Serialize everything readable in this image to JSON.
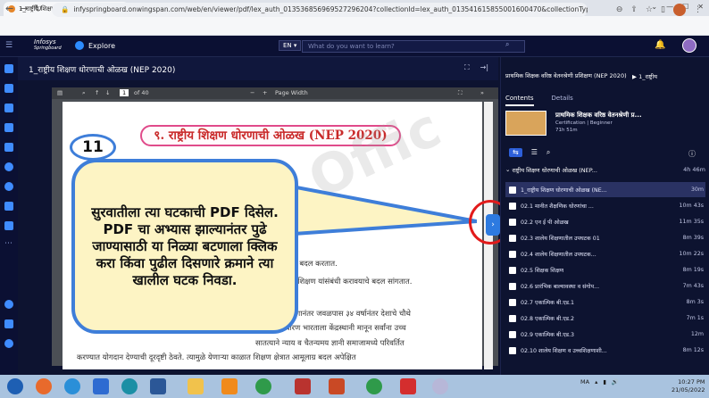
{
  "browser": {
    "tab_title": "1_राष्ट्रीय शिक्षण धोरणाची ओळख (NE",
    "tab_close": "×",
    "new_tab": "+",
    "url": "infyspringboard.onwingspan.com/web/en/viewer/pdf/lex_auth_013536856969527296204?collectionId=lex_auth_013541615855001600470&collectionType=C...",
    "window_controls": [
      "⌄",
      "—",
      "☐",
      "✕"
    ]
  },
  "header": {
    "logo_line1": "Infosys",
    "logo_line2": "Springboard",
    "explore_label": "Explore",
    "language": "EN",
    "search_placeholder": "What do you want to learn?"
  },
  "course": {
    "title": "1_राष्ट्रीय शिक्षण धोरणाची ओळख (NEP 2020)"
  },
  "pdf": {
    "page_label": "1",
    "page_total": "of 40",
    "zoom": "Page Width",
    "zoom_minus": "−",
    "zoom_plus": "+",
    "heading": "९. राष्ट्रीय शिक्षण धोरणाची ओळख (NEP 2020)",
    "lines": [
      "तात.",
      "अनुरूप बदल करतात.",
      "शिक्षक शिक्षण यांसंबंधी करावयाचे बदल सांगतात.",
      "क धोरणानंतर जवळपास ३४ वर्षानंतर देशाचे चौथे",
      "क धोरण भारताला केंद्रस्थानी मानून सर्वांना उच्च",
      "सातत्याने न्याय व चैतन्यमय ज्ञानी समाजामध्ये परिवर्तित",
      "करण्यात योगदान देण्याची दूरदृष्टी ठेवते. त्यामुळे येणाऱ्या काळात शिक्षण क्षेत्रात आमूलाग्र बदल अपेक्षित"
    ],
    "watermark": "PS Offic"
  },
  "annotation": {
    "badge": "11",
    "callout": "सुरवातीला त्या घटकाची PDF दिसेल. PDF चा अभ्यास झाल्यानंतर पुढे जाण्यासाठी या निळ्या बटणाला क्लिक करा किंवा पुढील दिसणारे क्रमाने त्या खालील घटक निवडा."
  },
  "panel": {
    "title": "प्राथमिक शिक्षक वरिष्ठ वेतनश्रेणी प्रशिक्षण (NEP 2020)",
    "breadcrumb_arrow": "▶",
    "breadcrumb_current": "1_राष्ट्रीय",
    "tabs": [
      "Contents",
      "Details"
    ],
    "card_title": "प्राथमिक शिक्षक वरिष्ठ वेतनश्रेणी प्र...",
    "card_level": "Certification | Beginner",
    "card_duration": "71h 51m",
    "module_title": "राष्ट्रीय शिक्षण धोरणाची ओळख (NEP...",
    "module_duration": "4h 46m",
    "items": [
      {
        "label": "1_राष्ट्रीय शिक्षण धोरणाची ओळख (NE...",
        "duration": "30m"
      },
      {
        "label": "02.1 मानीत शैक्षणिक धोरणांचा ...",
        "duration": "10m 43s"
      },
      {
        "label": "02.2 एन ई पी ओळख",
        "duration": "11m 35s"
      },
      {
        "label": "02.3 शालेय शिक्षणातील उपघटक 01",
        "duration": "8m 39s"
      },
      {
        "label": "02.4 शालेय शिक्षणातील उपघटक...",
        "duration": "10m 22s"
      },
      {
        "label": "02.5 शिक्षक शिक्षण",
        "duration": "8m 19s"
      },
      {
        "label": "02.6 प्रारंभिक बाल्यावस्था व संगोप...",
        "duration": "7m 43s"
      },
      {
        "label": "02.7 एकात्मिक बी.एड.1",
        "duration": "8m 3s"
      },
      {
        "label": "02.8 एकात्मिक बी.एड.2",
        "duration": "7m 1s"
      },
      {
        "label": "02.9 एकात्मिक बी.एड.3",
        "duration": "12m"
      },
      {
        "label": "02.10 शालेय शिक्षण व उच्चशिक्षणाशी...",
        "duration": "8m 12s"
      }
    ]
  },
  "taskbar": {
    "tray": "MA",
    "time": "10:27 PM",
    "date": "21/05/2022"
  }
}
